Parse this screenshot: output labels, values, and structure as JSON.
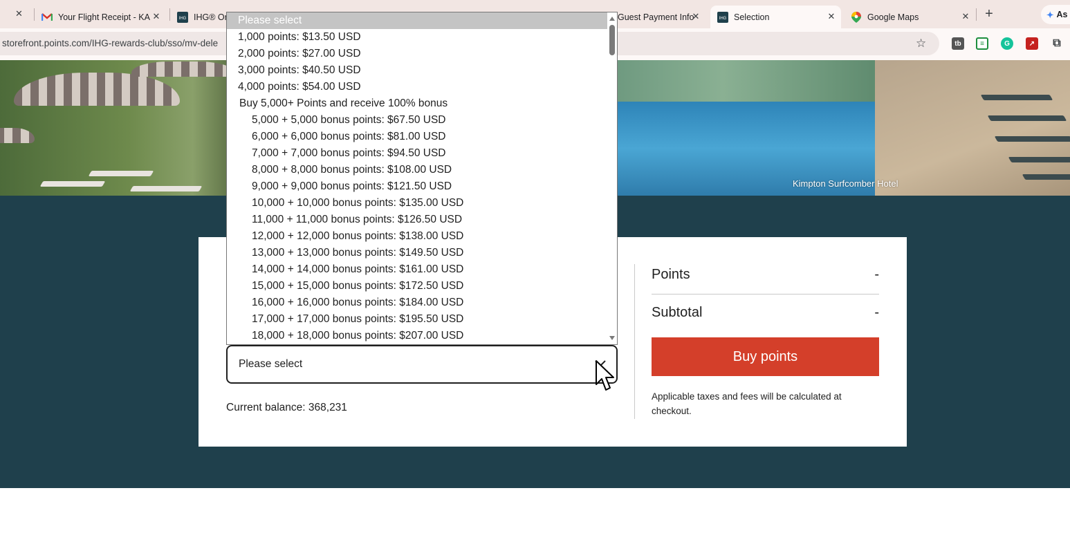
{
  "browser": {
    "tabs": [
      {
        "title": "",
        "icon": "close-icon",
        "active": false
      },
      {
        "title": "Your Flight Receipt - KA",
        "icon": "gmail-icon",
        "active": false
      },
      {
        "title": "IHG® On",
        "icon": "ihg-icon",
        "active": false
      },
      {
        "title": "",
        "icon": "docs-icon",
        "active": false
      },
      {
        "title": "",
        "icon": "page-icon",
        "active": false
      },
      {
        "title": "Guest Payment Info",
        "icon": "page-icon",
        "active": false
      },
      {
        "title": "Selection",
        "icon": "ihg-icon",
        "active": true
      },
      {
        "title": "Google Maps",
        "icon": "maps-icon",
        "active": false
      }
    ],
    "assistant_label": "As",
    "url": "storefront.points.com/IHG-rewards-club/sso/mv-dele",
    "extensions": [
      "tb-icon",
      "sheet-icon",
      "grammarly-icon",
      "pdf-icon",
      "puzzle-icon"
    ]
  },
  "hero": {
    "caption": "Kimpton Surfcomber Hotel"
  },
  "purchase": {
    "select_value": "Please select",
    "balance_text": "Current balance: 368,231"
  },
  "dropdown": {
    "options": [
      {
        "label": "Please select",
        "kind": "selected"
      },
      {
        "label": "1,000 points: $13.50 USD",
        "kind": "lvl0"
      },
      {
        "label": "2,000 points: $27.00 USD",
        "kind": "lvl0"
      },
      {
        "label": "3,000 points: $40.50 USD",
        "kind": "lvl0"
      },
      {
        "label": "4,000 points: $54.00 USD",
        "kind": "lvl0"
      },
      {
        "label": "Buy 5,000+ Points and receive 100% bonus",
        "kind": "grp"
      },
      {
        "label": "5,000 + 5,000 bonus points: $67.50 USD",
        "kind": "lvl1"
      },
      {
        "label": "6,000 + 6,000 bonus points: $81.00 USD",
        "kind": "lvl1"
      },
      {
        "label": "7,000 + 7,000 bonus points: $94.50 USD",
        "kind": "lvl1"
      },
      {
        "label": "8,000 + 8,000 bonus points: $108.00 USD",
        "kind": "lvl1"
      },
      {
        "label": "9,000 + 9,000 bonus points: $121.50 USD",
        "kind": "lvl1"
      },
      {
        "label": "10,000 + 10,000 bonus points: $135.00 USD",
        "kind": "lvl1"
      },
      {
        "label": "11,000 + 11,000 bonus points: $126.50 USD",
        "kind": "lvl1"
      },
      {
        "label": "12,000 + 12,000 bonus points: $138.00 USD",
        "kind": "lvl1"
      },
      {
        "label": "13,000 + 13,000 bonus points: $149.50 USD",
        "kind": "lvl1"
      },
      {
        "label": "14,000 + 14,000 bonus points: $161.00 USD",
        "kind": "lvl1"
      },
      {
        "label": "15,000 + 15,000 bonus points: $172.50 USD",
        "kind": "lvl1"
      },
      {
        "label": "16,000 + 16,000 bonus points: $184.00 USD",
        "kind": "lvl1"
      },
      {
        "label": "17,000 + 17,000 bonus points: $195.50 USD",
        "kind": "lvl1"
      },
      {
        "label": "18,000 + 18,000 bonus points: $207.00 USD",
        "kind": "lvl1"
      }
    ]
  },
  "summary": {
    "points_label": "Points",
    "points_value": "-",
    "subtotal_label": "Subtotal",
    "subtotal_value": "-",
    "buy_label": "Buy points",
    "note": "Applicable taxes and fees will be calculated at checkout."
  },
  "colors": {
    "band": "#1f404c",
    "buy_button": "#d43f2a",
    "tab_strip": "#f2e6e3"
  }
}
